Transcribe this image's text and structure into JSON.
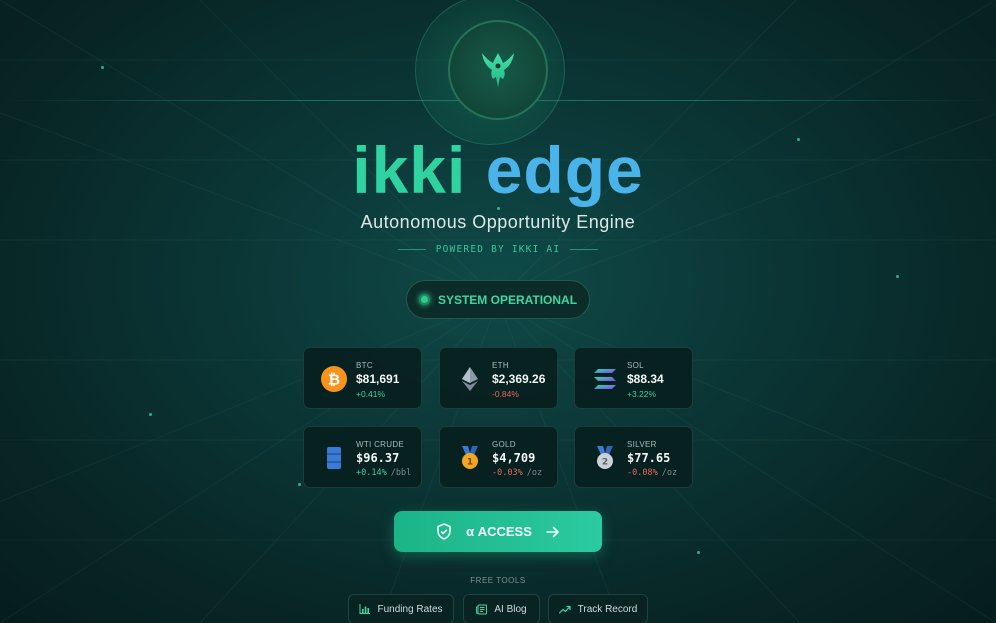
{
  "brand": {
    "word1": "ikki",
    "word2": "edge"
  },
  "tagline": "Autonomous Opportunity Engine",
  "powered_by": "POWERED BY IKKI AI",
  "status": {
    "label": "SYSTEM OPERATIONAL"
  },
  "tickers": [
    {
      "symbol": "BTC",
      "price": "$81,691",
      "change": "+0.41%",
      "unit": "",
      "direction": "up",
      "icon": "bitcoin-icon"
    },
    {
      "symbol": "ETH",
      "price": "$2,369.26",
      "change": "-0.84%",
      "unit": "",
      "direction": "down",
      "icon": "ethereum-icon"
    },
    {
      "symbol": "SOL",
      "price": "$88.34",
      "change": "+3.22%",
      "unit": "",
      "direction": "up",
      "icon": "solana-icon"
    },
    {
      "symbol": "WTI CRUDE",
      "price": "$96.37",
      "change": "+0.14%",
      "unit": "/bbl",
      "direction": "up",
      "icon": "oil-barrel-icon"
    },
    {
      "symbol": "GOLD",
      "price": "$4,709",
      "change": "-0.03%",
      "unit": "/oz",
      "direction": "down",
      "icon": "gold-medal-icon"
    },
    {
      "symbol": "SILVER",
      "price": "$77.65",
      "change": "-0.08%",
      "unit": "/oz",
      "direction": "down",
      "icon": "silver-medal-icon"
    }
  ],
  "access_button": {
    "label": "α ACCESS"
  },
  "free_tools": {
    "heading": "FREE TOOLS",
    "items": [
      {
        "label": "Funding Rates",
        "icon": "bar-chart-icon"
      },
      {
        "label": "AI Blog",
        "icon": "newspaper-icon"
      },
      {
        "label": "Track Record",
        "icon": "trend-up-icon"
      }
    ]
  },
  "colors": {
    "accent": "#2ed3a0",
    "accent_blue": "#4ab3ea",
    "up": "#35d39b",
    "down": "#e8675d"
  }
}
